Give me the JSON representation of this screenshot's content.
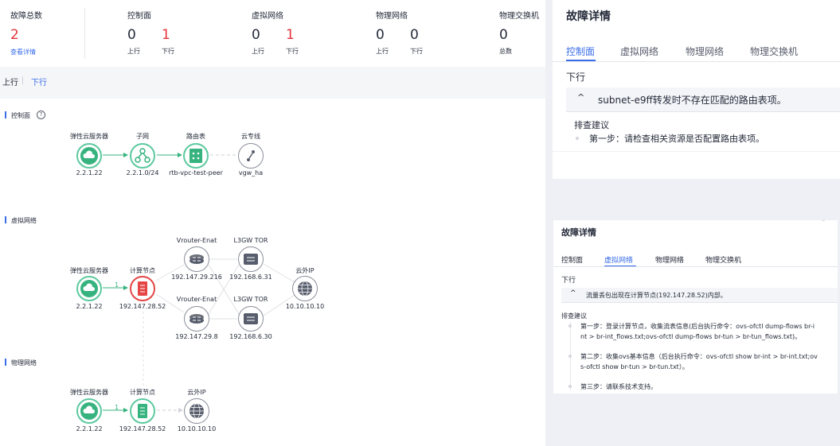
{
  "summary": {
    "total": {
      "title": "故障总数",
      "value": "2",
      "link": "查看详情"
    },
    "control": {
      "title": "控制面",
      "up": "0",
      "down": "1",
      "up_label": "上行",
      "down_label": "下行"
    },
    "virtual": {
      "title": "虚拟网络",
      "up": "0",
      "down": "1",
      "up_label": "上行",
      "down_label": "下行"
    },
    "physical": {
      "title": "物理网络",
      "up": "0",
      "down": "0",
      "up_label": "上行",
      "down_label": "下行"
    },
    "switch": {
      "title": "物理交换机",
      "value": "0",
      "label": "总数"
    }
  },
  "direction_tabs": {
    "up": "上行",
    "down": "下行"
  },
  "diagram": {
    "control": {
      "title": "控制面",
      "nodes": [
        {
          "name": "弹性云服务器",
          "sub": "2.2.1.22"
        },
        {
          "name": "子网",
          "sub": "2.2.1.0/24"
        },
        {
          "name": "路由表",
          "sub": "rtb-vpc-test-peer"
        },
        {
          "name": "云专线",
          "sub": "vgw_ha"
        }
      ]
    },
    "virtual": {
      "title": "虚拟网络",
      "ecs": {
        "name": "弹性云服务器",
        "sub": "2.2.1.22"
      },
      "edge_label": "1",
      "compute": {
        "name": "计算节点",
        "sub": "192.147.28.52"
      },
      "vrouter1": {
        "name": "Vrouter-Enat",
        "sub": "192.147.29.216"
      },
      "vrouter2": {
        "name": "Vrouter-Enat",
        "sub": "192.147.29.8"
      },
      "l3gw1": {
        "name": "L3GW TOR",
        "sub": "192.168.6.31"
      },
      "l3gw2": {
        "name": "L3GW TOR",
        "sub": "192.168.6.30"
      },
      "extip": {
        "name": "云外IP",
        "sub": "10.10.10.10"
      }
    },
    "physical": {
      "title": "物理网络",
      "ecs": {
        "name": "弹性云服务器",
        "sub": "2.2.1.22"
      },
      "edge_label": "1",
      "compute": {
        "name": "计算节点",
        "sub": "192.147.28.52"
      },
      "extip": {
        "name": "云外IP",
        "sub": "10.10.10.10"
      }
    }
  },
  "detail1": {
    "title": "故障详情",
    "tabs": [
      "控制面",
      "虚拟网络",
      "物理网络",
      "物理交换机"
    ],
    "direction": "下行",
    "fault": "subnet-e9ff转发时不存在匹配的路由表项。",
    "advice_title": "排查建议",
    "steps": [
      "第一步：请检查相关资源是否配置路由表项。"
    ]
  },
  "detail2": {
    "title": "故障详情",
    "tabs": [
      "控制面",
      "虚拟网络",
      "物理网络",
      "物理交换机"
    ],
    "direction": "下行",
    "fault": "流量丢包出现在计算节点(192.147.28.52)内部。",
    "advice_title": "排查建议",
    "steps": [
      {
        "l1": "第一步：登录计算节点，收集流表信息(后台执行命令：ovs-ofctl dump-flows br-i",
        "l2": "nt > br-int_flows.txt;ovs-ofctl dump-flows br-tun > br-tun_flows.txt)。"
      },
      {
        "l1": "第二步：收集ovs基本信息（后台执行命令：ovs-ofctl show br-int > br-int.txt;ov",
        "l2": "s-ofctl show br-tun > br-tun.txt）。"
      },
      {
        "l1": "第三步：请联系技术支持。",
        "l2": ""
      }
    ]
  }
}
